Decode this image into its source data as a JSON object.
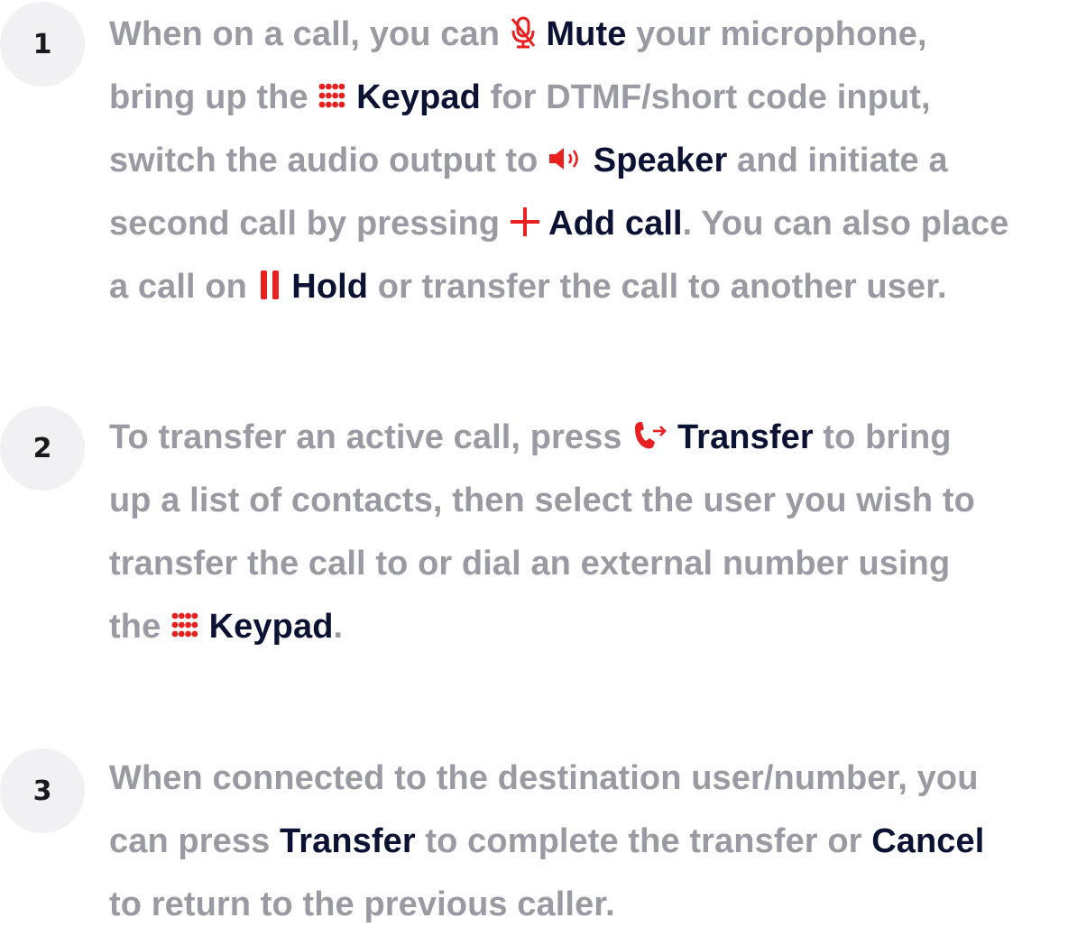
{
  "colors": {
    "text_muted": "#9a9aa3",
    "text_strong": "#0b1233",
    "accent_red": "#e8201f",
    "badge_bg": "#f1f1f4"
  },
  "steps": [
    {
      "number": "1",
      "lines": [
        {
          "t1": "When on a call, you can ",
          "icon": "mic-muted-icon",
          "k1": "Mute",
          "t2": " your microphone,"
        },
        {
          "t1": "bring up the ",
          "icon": "keypad-icon",
          "k1": "Keypad",
          "t2": " for DTMF/short code input,"
        },
        {
          "t1": "switch the audio output to ",
          "icon": "speaker-icon",
          "k1": "Speaker",
          "t2": " and initiate a"
        },
        {
          "t1": "second call by pressing ",
          "icon": "plus-icon",
          "k1": "Add call",
          "t2": ". You can also place"
        },
        {
          "t1": "a call on ",
          "icon": "pause-icon",
          "k1": "Hold",
          "t2": " or transfer the call to another user."
        }
      ]
    },
    {
      "number": "2",
      "lines": [
        {
          "t1": "To transfer an active call, press ",
          "icon": "phone-transfer-icon",
          "k1": "Transfer",
          "t2": " to bring"
        },
        {
          "t1": "up a list of contacts, then select the user you wish to"
        },
        {
          "t1": "transfer the call to or dial an external number using"
        },
        {
          "t1": "the ",
          "icon": "keypad-icon",
          "k1": "Keypad",
          "t2": "."
        }
      ]
    },
    {
      "number": "3",
      "lines": [
        {
          "t1": "When connected to the destination user/number, you"
        },
        {
          "t1": "can press ",
          "k1": "Transfer",
          "t2": " to complete the transfer or ",
          "k2": "Cancel"
        },
        {
          "t1": "to return to the previous caller."
        }
      ]
    }
  ]
}
